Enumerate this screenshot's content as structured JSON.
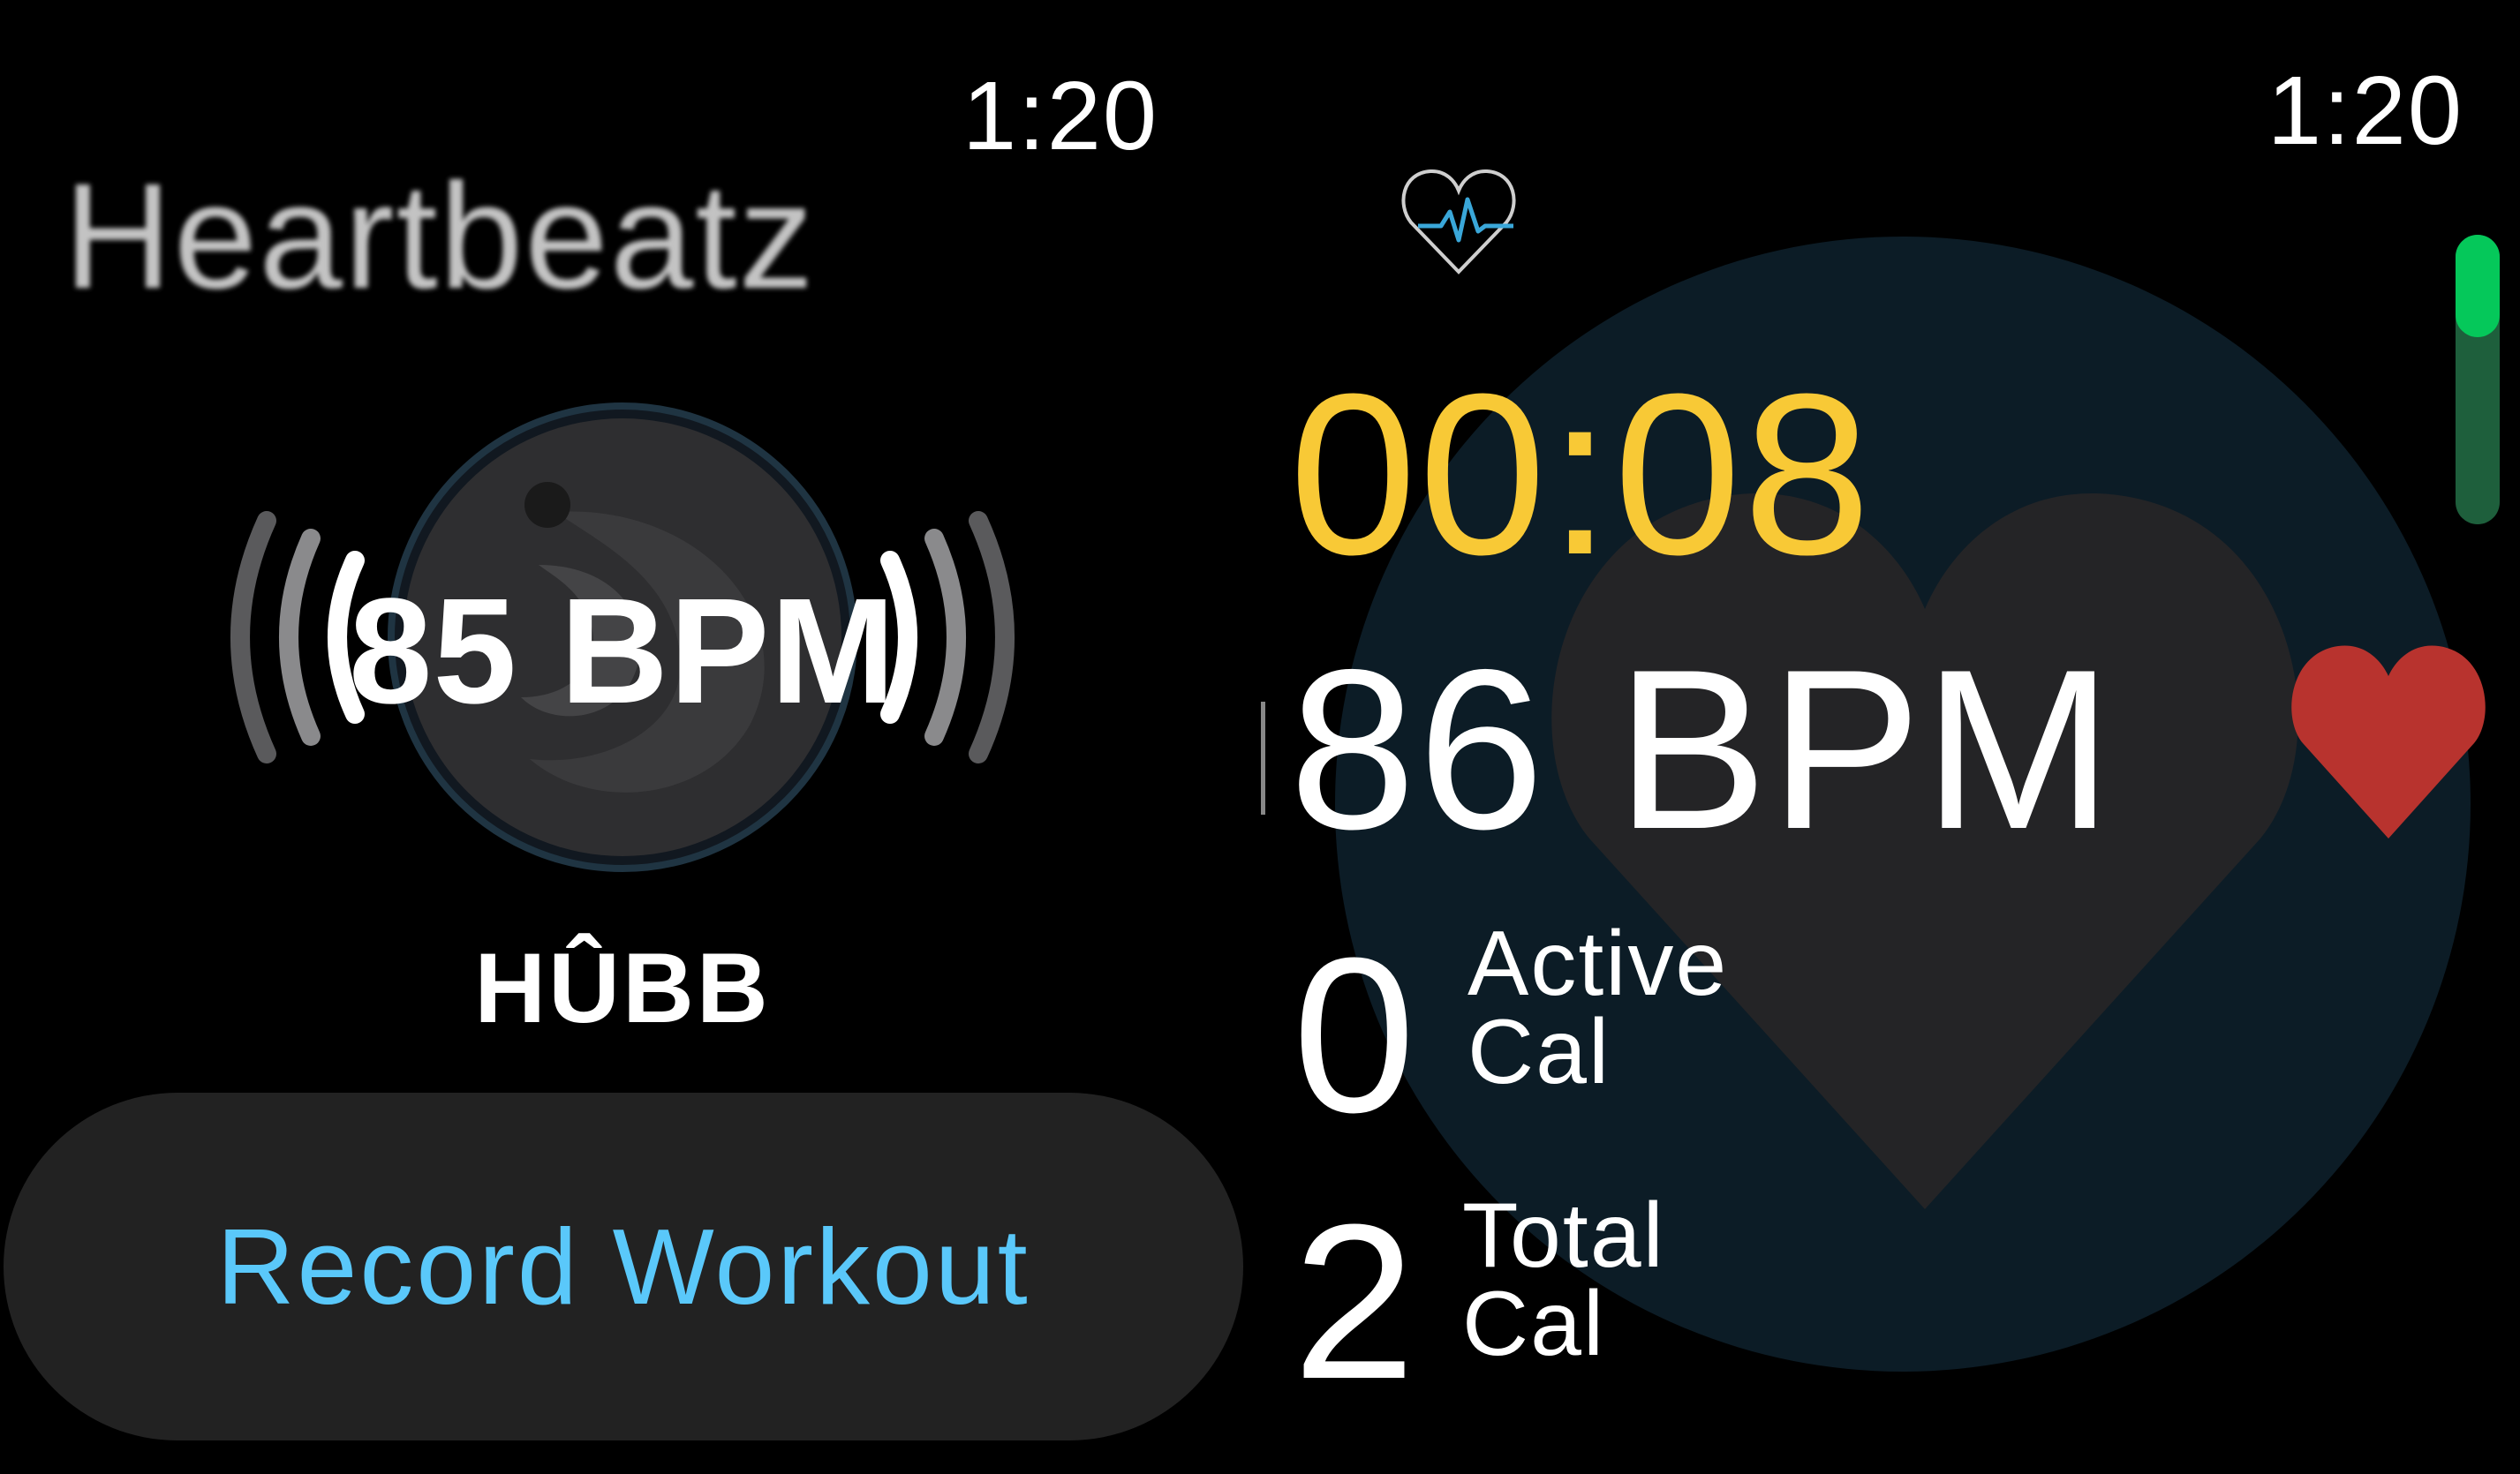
{
  "left_screen": {
    "clock": "1:20",
    "app_title": "Heartbeatz",
    "bpm_display": "85 BPM",
    "device_name": "HÛBB",
    "record_button_label": "Record Workout"
  },
  "right_screen": {
    "clock": "1:20",
    "elapsed_time": "00:08",
    "heart_rate_value": "86",
    "heart_rate_unit": "BPM",
    "active_calories_value": "0",
    "active_calories_label_line1": "Active",
    "active_calories_label_line2": "Cal",
    "total_calories_value": "2",
    "total_calories_label_line1": "Total",
    "total_calories_label_line2": "Cal",
    "scroll_position_fraction": 0.35
  },
  "colors": {
    "background": "#000000",
    "button_background": "#222222",
    "button_text": "#5ac8fa",
    "timer": "#f8c936",
    "heart": "#c0392b",
    "ring_background": "#0c1c26",
    "scroll_track": "#1e5f3c",
    "scroll_thumb": "#05c85a"
  },
  "icons": {
    "left_center": "broadcast-heart-sensor-icon",
    "right_top": "heart-pulse-logo-icon",
    "right_live": "heart-icon",
    "watermark": "heart-watermark-icon"
  }
}
